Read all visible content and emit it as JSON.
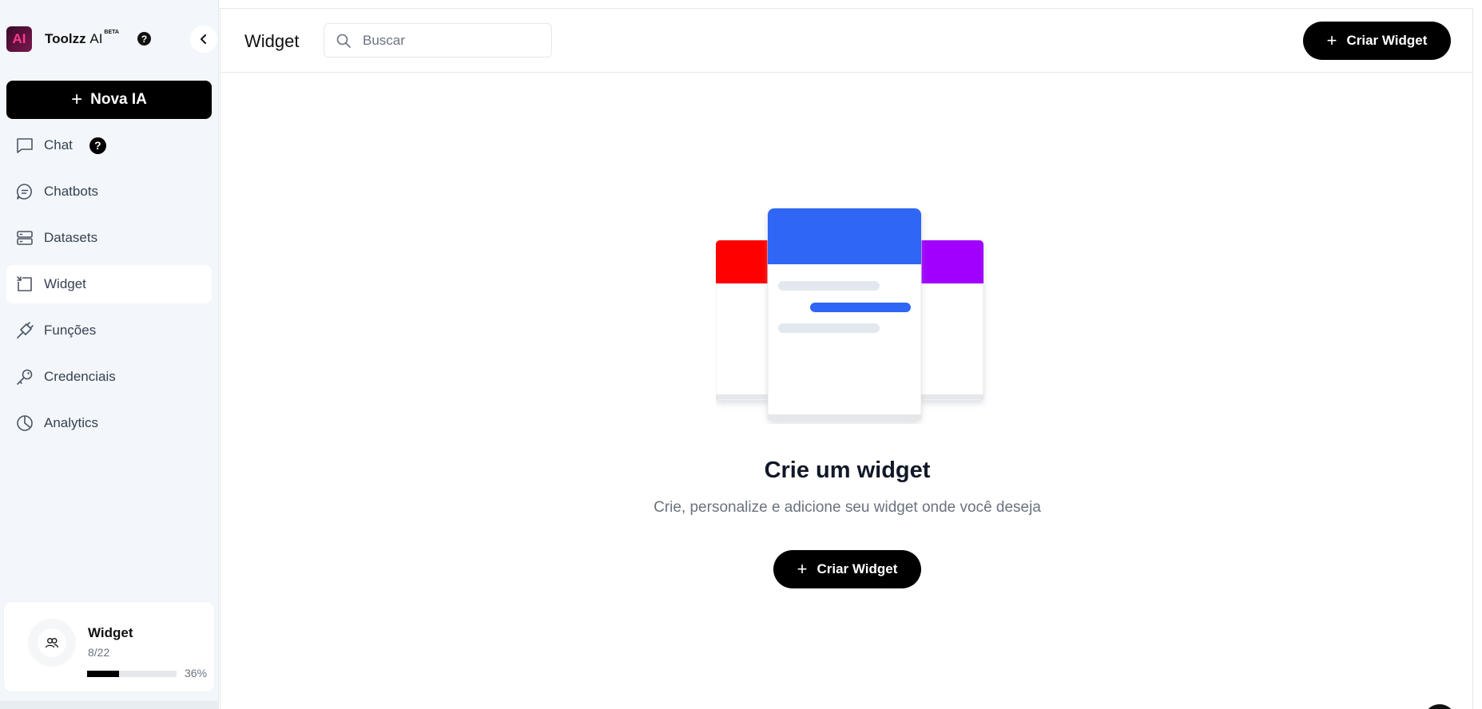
{
  "brand": {
    "logo": "AI",
    "name": "Toolzz",
    "name_suffix": "AI",
    "badge": "BETA",
    "help": "?"
  },
  "sidebar": {
    "new_button": "Nova IA",
    "items": [
      {
        "label": "Chat",
        "icon": "chat-icon",
        "help": "?"
      },
      {
        "label": "Chatbots",
        "icon": "chatbot-icon"
      },
      {
        "label": "Datasets",
        "icon": "database-icon"
      },
      {
        "label": "Widget",
        "icon": "widget-icon",
        "active": true
      },
      {
        "label": "Funções",
        "icon": "plug-icon"
      },
      {
        "label": "Credenciais",
        "icon": "key-icon"
      },
      {
        "label": "Analytics",
        "icon": "pie-chart-icon"
      }
    ],
    "usage": {
      "title": "Widget",
      "count": "8/22",
      "percent_label": "36%",
      "progress": 0.36
    }
  },
  "header": {
    "title": "Widget",
    "search_placeholder": "Buscar",
    "create_button": "Criar Widget"
  },
  "empty_state": {
    "title": "Crie um widget",
    "subtitle": "Crie, personalize e adicione seu widget onde você deseja",
    "create_button": "Criar Widget"
  },
  "colors": {
    "accent": "#000000",
    "card_left": "#ff0000",
    "card_center": "#2f66f6",
    "card_right": "#a100ff"
  }
}
